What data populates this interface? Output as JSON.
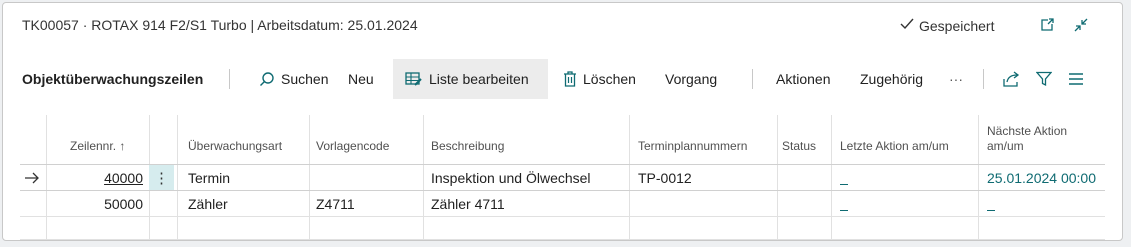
{
  "window": {
    "title": "TK00057 · ROTAX 914 F2/S1 Turbo | Arbeitsdatum: 25.01.2024",
    "saved_label": "Gespeichert"
  },
  "actionbar": {
    "page_title": "Objektüberwachungszeilen",
    "search_label": "Suchen",
    "new_label": "Neu",
    "edit_list_label": "Liste bearbeiten",
    "delete_label": "Löschen",
    "process_label": "Vorgang",
    "actions_label": "Aktionen",
    "related_label": "Zugehörig",
    "more_label": "···"
  },
  "table": {
    "headers": {
      "line_no": "Zeilennr. ↑",
      "type": "Überwachungsart",
      "template": "Vorlagencode",
      "description": "Beschreibung",
      "schedule": "Terminplannummern",
      "status": "Status",
      "last_action": "Letzte Aktion am/um",
      "next_action_1": "Nächste Aktion",
      "next_action_2": "am/um"
    },
    "rows": [
      {
        "line_no": "40000",
        "type": "Termin",
        "template": "",
        "description": "Inspektion und Ölwechsel",
        "schedule": "TP-0012",
        "status": "",
        "last_action": "",
        "next_action": "25.01.2024 00:00"
      },
      {
        "line_no": "50000",
        "type": "Zähler",
        "template": "Z4711",
        "description": "Zähler 4711",
        "schedule": "",
        "status": "",
        "last_action": "",
        "next_action": ""
      }
    ]
  },
  "colors": {
    "accent": "#0f6b72",
    "selected_bg": "#d6ecee",
    "active_action_bg": "#ececec"
  },
  "icons": [
    "checkmark-icon",
    "open-in-new-icon",
    "collapse-icon",
    "search-icon",
    "edit-list-icon",
    "delete-icon",
    "share-icon",
    "filter-icon",
    "list-view-icon",
    "row-arrow-icon",
    "row-menu-icon"
  ]
}
